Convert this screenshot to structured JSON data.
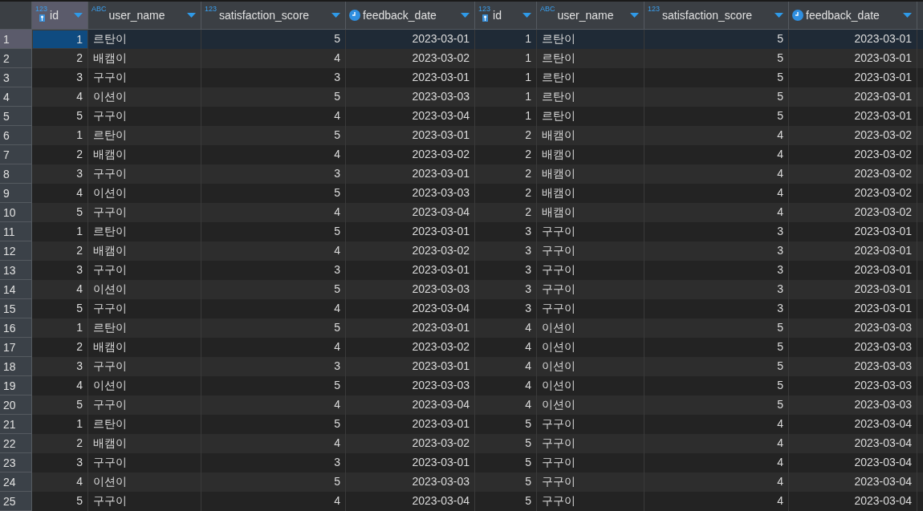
{
  "grid": {
    "columns": [
      {
        "name": "id",
        "kind": "number",
        "badge": "123",
        "key": true,
        "selected": true
      },
      {
        "name": "user_name",
        "kind": "text",
        "badge": "ABC",
        "key": false,
        "selected": false
      },
      {
        "name": "satisfaction_score",
        "kind": "number",
        "badge": "123",
        "key": false,
        "selected": false
      },
      {
        "name": "feedback_date",
        "kind": "date",
        "key": false,
        "selected": false
      },
      {
        "name": "id",
        "kind": "number",
        "badge": "123",
        "key": true,
        "selected": false
      },
      {
        "name": "user_name",
        "kind": "text",
        "badge": "ABC",
        "key": false,
        "selected": false
      },
      {
        "name": "satisfaction_score",
        "kind": "number",
        "badge": "123",
        "key": false,
        "selected": false
      },
      {
        "name": "feedback_date",
        "kind": "date",
        "key": false,
        "selected": false
      }
    ],
    "rows": [
      {
        "number": "1",
        "selected": true,
        "cells": [
          "1",
          "르탄이",
          "5",
          "2023-03-01",
          "1",
          "르탄이",
          "5",
          "2023-03-01"
        ]
      },
      {
        "number": "2",
        "selected": false,
        "cells": [
          "2",
          "배캠이",
          "4",
          "2023-03-02",
          "1",
          "르탄이",
          "5",
          "2023-03-01"
        ]
      },
      {
        "number": "3",
        "selected": false,
        "cells": [
          "3",
          "구구이",
          "3",
          "2023-03-01",
          "1",
          "르탄이",
          "5",
          "2023-03-01"
        ]
      },
      {
        "number": "4",
        "selected": false,
        "cells": [
          "4",
          "이션이",
          "5",
          "2023-03-03",
          "1",
          "르탄이",
          "5",
          "2023-03-01"
        ]
      },
      {
        "number": "5",
        "selected": false,
        "cells": [
          "5",
          "구구이",
          "4",
          "2023-03-04",
          "1",
          "르탄이",
          "5",
          "2023-03-01"
        ]
      },
      {
        "number": "6",
        "selected": false,
        "cells": [
          "1",
          "르탄이",
          "5",
          "2023-03-01",
          "2",
          "배캠이",
          "4",
          "2023-03-02"
        ]
      },
      {
        "number": "7",
        "selected": false,
        "cells": [
          "2",
          "배캠이",
          "4",
          "2023-03-02",
          "2",
          "배캠이",
          "4",
          "2023-03-02"
        ]
      },
      {
        "number": "8",
        "selected": false,
        "cells": [
          "3",
          "구구이",
          "3",
          "2023-03-01",
          "2",
          "배캠이",
          "4",
          "2023-03-02"
        ]
      },
      {
        "number": "9",
        "selected": false,
        "cells": [
          "4",
          "이션이",
          "5",
          "2023-03-03",
          "2",
          "배캠이",
          "4",
          "2023-03-02"
        ]
      },
      {
        "number": "10",
        "selected": false,
        "cells": [
          "5",
          "구구이",
          "4",
          "2023-03-04",
          "2",
          "배캠이",
          "4",
          "2023-03-02"
        ]
      },
      {
        "number": "11",
        "selected": false,
        "cells": [
          "1",
          "르탄이",
          "5",
          "2023-03-01",
          "3",
          "구구이",
          "3",
          "2023-03-01"
        ]
      },
      {
        "number": "12",
        "selected": false,
        "cells": [
          "2",
          "배캠이",
          "4",
          "2023-03-02",
          "3",
          "구구이",
          "3",
          "2023-03-01"
        ]
      },
      {
        "number": "13",
        "selected": false,
        "cells": [
          "3",
          "구구이",
          "3",
          "2023-03-01",
          "3",
          "구구이",
          "3",
          "2023-03-01"
        ]
      },
      {
        "number": "14",
        "selected": false,
        "cells": [
          "4",
          "이션이",
          "5",
          "2023-03-03",
          "3",
          "구구이",
          "3",
          "2023-03-01"
        ]
      },
      {
        "number": "15",
        "selected": false,
        "cells": [
          "5",
          "구구이",
          "4",
          "2023-03-04",
          "3",
          "구구이",
          "3",
          "2023-03-01"
        ]
      },
      {
        "number": "16",
        "selected": false,
        "cells": [
          "1",
          "르탄이",
          "5",
          "2023-03-01",
          "4",
          "이션이",
          "5",
          "2023-03-03"
        ]
      },
      {
        "number": "17",
        "selected": false,
        "cells": [
          "2",
          "배캠이",
          "4",
          "2023-03-02",
          "4",
          "이션이",
          "5",
          "2023-03-03"
        ]
      },
      {
        "number": "18",
        "selected": false,
        "cells": [
          "3",
          "구구이",
          "3",
          "2023-03-01",
          "4",
          "이션이",
          "5",
          "2023-03-03"
        ]
      },
      {
        "number": "19",
        "selected": false,
        "cells": [
          "4",
          "이션이",
          "5",
          "2023-03-03",
          "4",
          "이션이",
          "5",
          "2023-03-03"
        ]
      },
      {
        "number": "20",
        "selected": false,
        "cells": [
          "5",
          "구구이",
          "4",
          "2023-03-04",
          "4",
          "이션이",
          "5",
          "2023-03-03"
        ]
      },
      {
        "number": "21",
        "selected": false,
        "cells": [
          "1",
          "르탄이",
          "5",
          "2023-03-01",
          "5",
          "구구이",
          "4",
          "2023-03-04"
        ]
      },
      {
        "number": "22",
        "selected": false,
        "cells": [
          "2",
          "배캠이",
          "4",
          "2023-03-02",
          "5",
          "구구이",
          "4",
          "2023-03-04"
        ]
      },
      {
        "number": "23",
        "selected": false,
        "cells": [
          "3",
          "구구이",
          "3",
          "2023-03-01",
          "5",
          "구구이",
          "4",
          "2023-03-04"
        ]
      },
      {
        "number": "24",
        "selected": false,
        "cells": [
          "4",
          "이션이",
          "5",
          "2023-03-03",
          "5",
          "구구이",
          "4",
          "2023-03-04"
        ]
      },
      {
        "number": "25",
        "selected": false,
        "cells": [
          "5",
          "구구이",
          "4",
          "2023-03-04",
          "5",
          "구구이",
          "4",
          "2023-03-04"
        ]
      }
    ]
  }
}
